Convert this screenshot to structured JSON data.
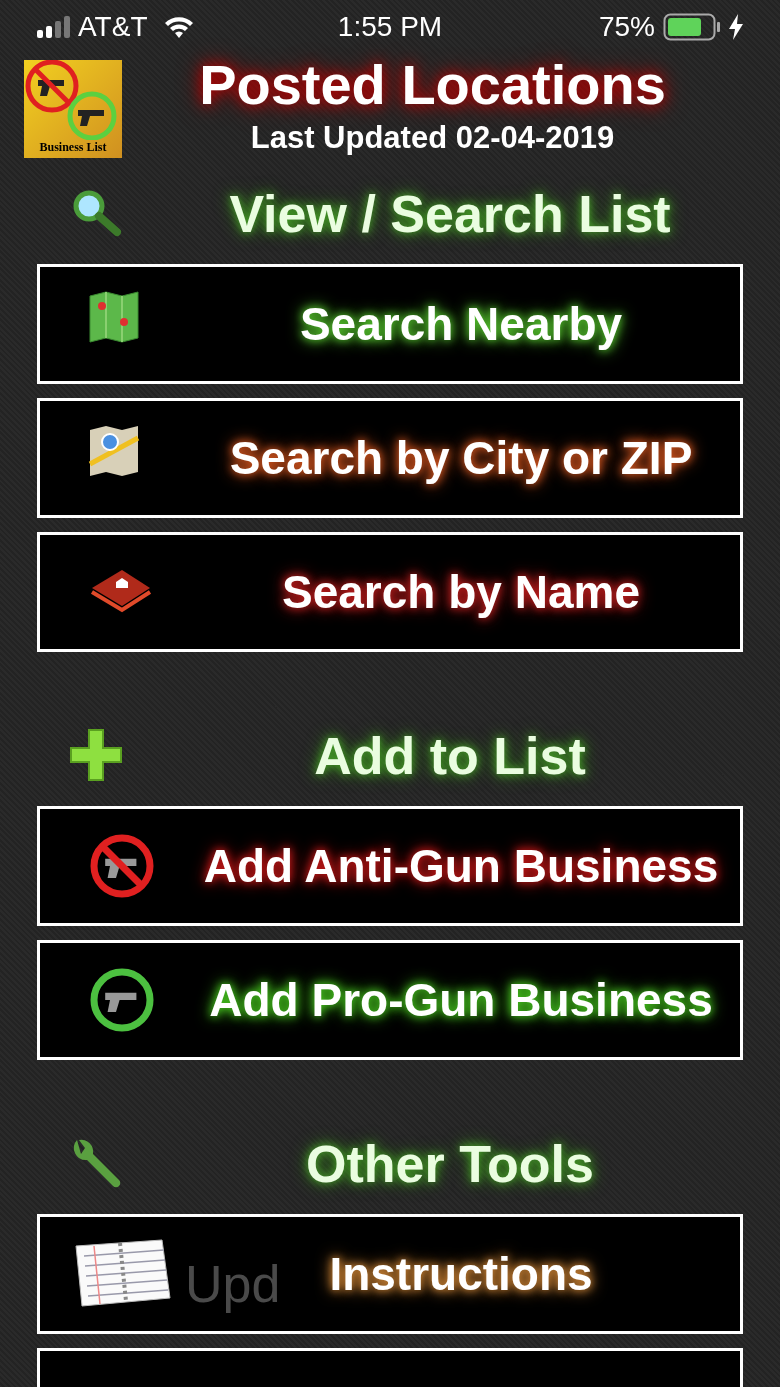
{
  "status_bar": {
    "carrier": "AT&T",
    "time": "1:55 PM",
    "battery": "75%",
    "level": 0.75
  },
  "header": {
    "logo_caption": "Business List",
    "title": "Posted Locations",
    "subtitle": "Last Updated 02-04-2019"
  },
  "sections": [
    {
      "title": "View / Search List",
      "buttons": [
        {
          "label": "Search Nearby"
        },
        {
          "label": "Search by City or ZIP"
        },
        {
          "label": "Search by Name"
        }
      ]
    },
    {
      "title": "Add to List",
      "buttons": [
        {
          "label": "Add Anti-Gun Business"
        },
        {
          "label": "Add Pro-Gun Business"
        }
      ]
    },
    {
      "title": "Other Tools",
      "more_below": true,
      "buttons": [
        {
          "label": "Instructions",
          "ghost_text": "Upd"
        }
      ]
    }
  ]
}
